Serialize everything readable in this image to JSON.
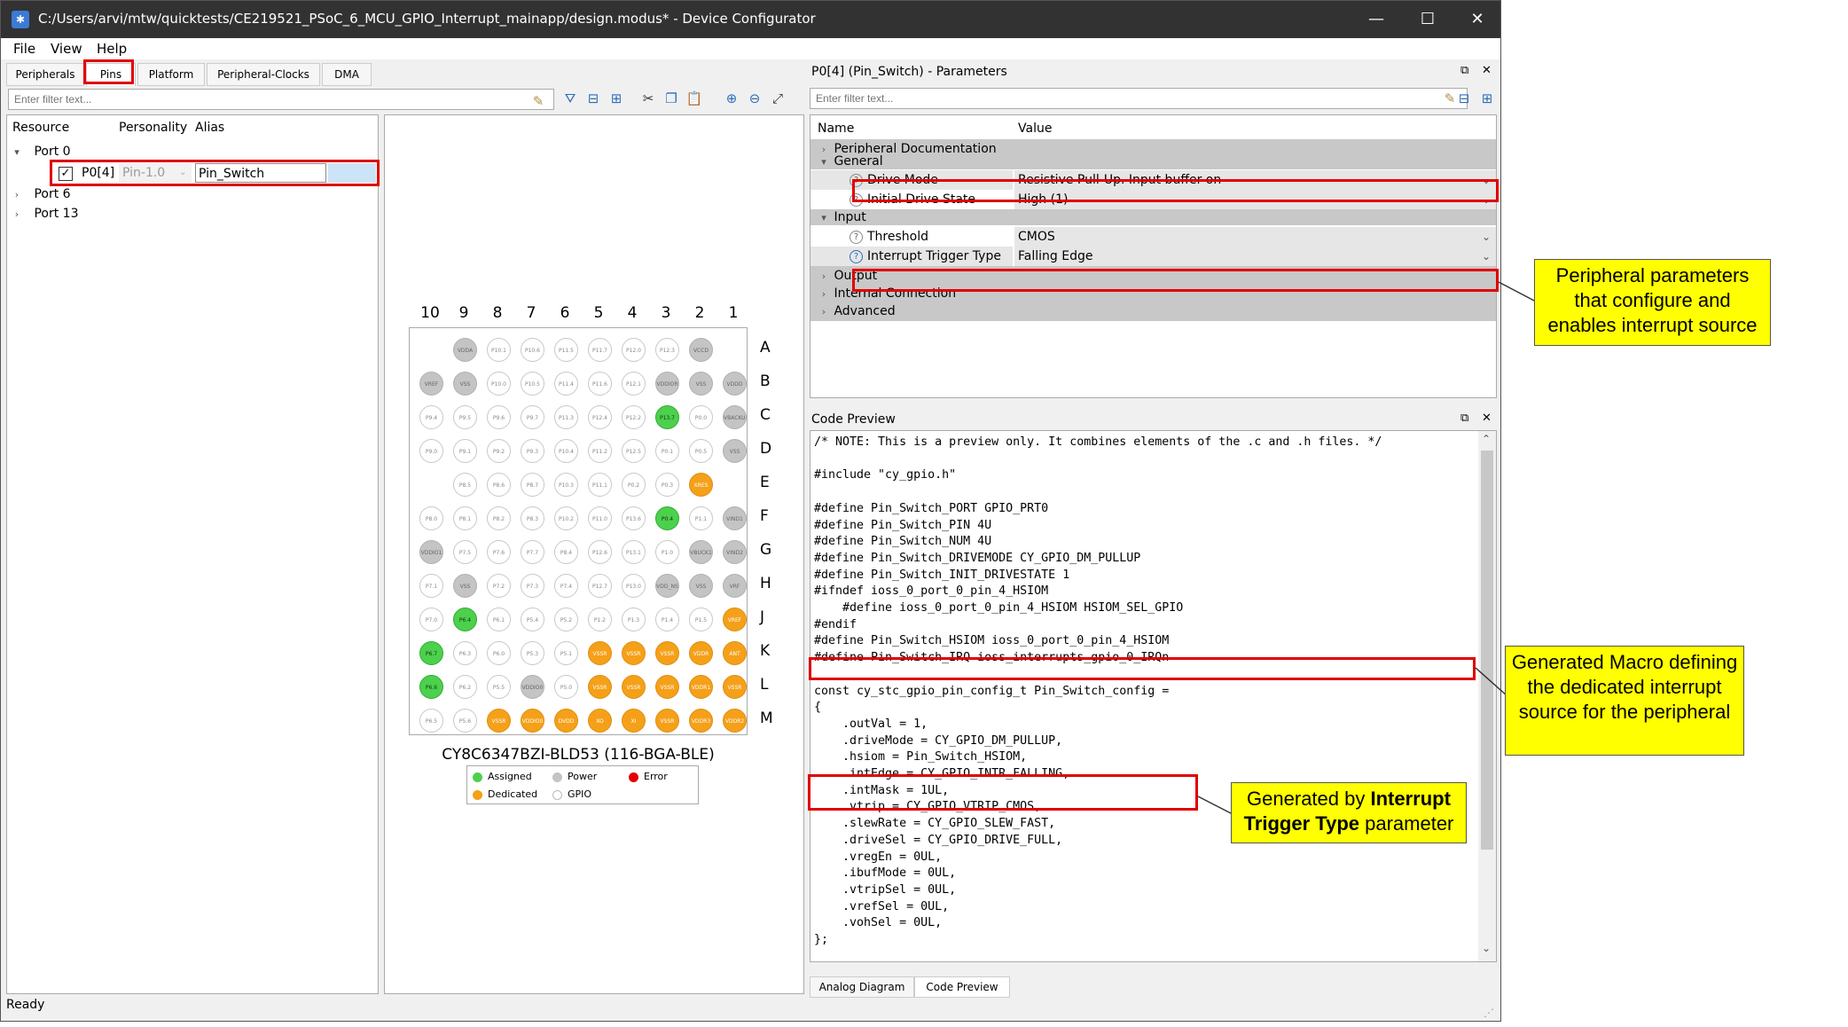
{
  "window": {
    "title": "C:/Users/arvi/mtw/quicktests/CE219521_PSoC_6_MCU_GPIO_Interrupt_mainapp/design.modus* - Device Configurator",
    "minimize": "—",
    "maximize": "☐",
    "close": "✕"
  },
  "menu": [
    "File",
    "View",
    "Help"
  ],
  "left": {
    "tabs": [
      "Peripherals",
      "Pins",
      "Platform",
      "Peripheral-Clocks",
      "DMA"
    ],
    "filter_placeholder": "Enter filter text...",
    "columns": [
      "Resource",
      "Personality",
      "Alias"
    ],
    "tree": {
      "port0": "Port 0",
      "pin_name": "P0[4]",
      "pin_personality": "Pin-1.0",
      "pin_alias": "Pin_Switch",
      "port6": "Port 6",
      "port13": "Port 13"
    }
  },
  "pinmap": {
    "columns": [
      "10",
      "9",
      "8",
      "7",
      "6",
      "5",
      "4",
      "3",
      "2",
      "1"
    ],
    "rows": [
      "A",
      "B",
      "C",
      "D",
      "E",
      "F",
      "G",
      "H",
      "J",
      "K",
      "L",
      "M"
    ],
    "grid": [
      [
        "",
        "p:VDDA",
        "g:P10.1",
        "g:P10.6",
        "g:P11.5",
        "g:P11.7",
        "g:P12.0",
        "g:P12.3",
        "p:VCCD",
        ""
      ],
      [
        "p:VREF",
        "p:VSS",
        "g:P10.0",
        "g:P10.5",
        "g:P11.4",
        "g:P11.6",
        "g:P12.1",
        "p:VDDIOR",
        "p:VSS",
        "p:VDDD"
      ],
      [
        "g:P9.4",
        "g:P9.5",
        "g:P9.6",
        "g:P9.7",
        "g:P11.3",
        "g:P12.4",
        "g:P12.2",
        "a:P13.7",
        "g:P0.0",
        "p:VBACKUP"
      ],
      [
        "g:P9.0",
        "g:P9.1",
        "g:P9.2",
        "g:P9.3",
        "g:P10.4",
        "g:P11.2",
        "g:P12.5",
        "g:P0.1",
        "g:P0.5",
        "p:VSS"
      ],
      [
        "",
        "g:P8.5",
        "g:P8.6",
        "g:P8.7",
        "g:P10.3",
        "g:P11.1",
        "g:P0.2",
        "g:P0.3",
        "d:XRES",
        ""
      ],
      [
        "g:P8.0",
        "g:P8.1",
        "g:P8.2",
        "g:P8.3",
        "g:P10.2",
        "g:P11.0",
        "g:P13.6",
        "a:P0.4",
        "g:P1.1",
        "p:VIND1"
      ],
      [
        "p:VDDIO1",
        "g:P7.5",
        "g:P7.6",
        "g:P7.7",
        "g:P8.4",
        "g:P12.6",
        "g:P13.1",
        "g:P1.0",
        "p:VBUCK1",
        "p:VIND2"
      ],
      [
        "g:P7.1",
        "p:VSS",
        "g:P7.2",
        "g:P7.3",
        "g:P7.4",
        "g:P12.7",
        "g:P13.0",
        "p:VDD_NS",
        "p:VSS",
        "p:VRF"
      ],
      [
        "g:P7.0",
        "a:P6.4",
        "g:P6.1",
        "g:P5.4",
        "g:P5.2",
        "g:P1.2",
        "g:P1.3",
        "g:P1.4",
        "g:P1.5",
        "d:VREF"
      ],
      [
        "a:P6.7",
        "g:P6.3",
        "g:P6.0",
        "g:P5.3",
        "g:P5.1",
        "d:VSSR",
        "d:VSSR",
        "d:VSSR",
        "d:VDDR",
        "d:ANT"
      ],
      [
        "a:P6.6",
        "g:P6.2",
        "g:P5.5",
        "p:VDDIO0",
        "g:P5.0",
        "d:VSSR",
        "d:VSSR",
        "d:VSSR",
        "d:VDDR1",
        "d:VSSR"
      ],
      [
        "g:P6.5",
        "g:P5.6",
        "d:VSSR",
        "d:VDDIO0",
        "d:DVDD",
        "d:XO",
        "d:XI",
        "d:VSSR",
        "d:VDDR3",
        "d:VDDR2"
      ]
    ],
    "chip": "CY8C6347BZI-BLD53 (116-BGA-BLE)",
    "legend": {
      "assigned": "Assigned",
      "power": "Power",
      "error": "Error",
      "dedicated": "Dedicated",
      "gpio": "GPIO"
    },
    "colors": {
      "assigned": "#4dd04d",
      "power": "#c4c4c4",
      "error": "#e00000",
      "dedicated": "#f5a019",
      "gpio": "#ffffff"
    }
  },
  "params": {
    "title": "P0[4] (Pin_Switch) - Parameters",
    "filter_placeholder": "Enter filter text...",
    "col_name": "Name",
    "col_value": "Value",
    "rows": {
      "periph_doc": "Peripheral Documentation",
      "general": "General",
      "drive_mode": "Drive Mode",
      "drive_mode_val": "Resistive Pull-Up. Input buffer on",
      "init_drive": "Initial Drive State",
      "init_drive_val": "High (1)",
      "input": "Input",
      "threshold": "Threshold",
      "threshold_val": "CMOS",
      "int_trigger": "Interrupt Trigger Type",
      "int_trigger_val": "Falling Edge",
      "output": "Output",
      "internal_conn": "Internal Connection",
      "advanced": "Advanced"
    }
  },
  "code": {
    "title": "Code Preview",
    "text": "/* NOTE: This is a preview only. It combines elements of the .c and .h files. */\n\n#include \"cy_gpio.h\"\n\n#define Pin_Switch_PORT GPIO_PRT0\n#define Pin_Switch_PIN 4U\n#define Pin_Switch_NUM 4U\n#define Pin_Switch_DRIVEMODE CY_GPIO_DM_PULLUP\n#define Pin_Switch_INIT_DRIVESTATE 1\n#ifndef ioss_0_port_0_pin_4_HSIOM\n    #define ioss_0_port_0_pin_4_HSIOM HSIOM_SEL_GPIO\n#endif\n#define Pin_Switch_HSIOM ioss_0_port_0_pin_4_HSIOM\n#define Pin_Switch_IRQ ioss_interrupts_gpio_0_IRQn\n\nconst cy_stc_gpio_pin_config_t Pin_Switch_config =\n{\n    .outVal = 1,\n    .driveMode = CY_GPIO_DM_PULLUP,\n    .hsiom = Pin_Switch_HSIOM,\n    .intEdge = CY_GPIO_INTR_FALLING,\n    .intMask = 1UL,\n    .vtrip = CY_GPIO_VTRIP_CMOS,\n    .slewRate = CY_GPIO_SLEW_FAST,\n    .driveSel = CY_GPIO_DRIVE_FULL,\n    .vregEn = 0UL,\n    .ibufMode = 0UL,\n    .vtripSel = 0UL,\n    .vrefSel = 0UL,\n    .vohSel = 0UL,\n};",
    "tabs": [
      "Analog Diagram",
      "Code Preview"
    ]
  },
  "status": "Ready",
  "callouts": {
    "params": "Peripheral parameters that configure and enables interrupt source",
    "macro": "Generated Macro defining the dedicated interrupt source for the peripheral",
    "trigger_prefix": "Generated by ",
    "trigger_bold": "Interrupt Trigger Type",
    "trigger_suffix": " parameter"
  }
}
